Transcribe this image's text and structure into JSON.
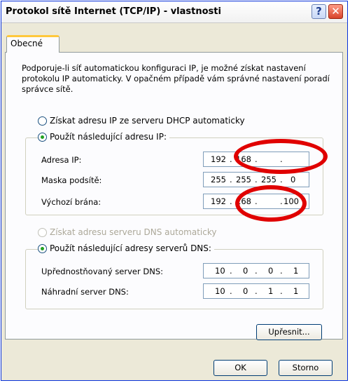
{
  "window": {
    "title": "Protokol sítě Internet (TCP/IP) - vlastnosti"
  },
  "titlebar": {
    "help_glyph": "?",
    "close_glyph": "✕"
  },
  "tabs": [
    {
      "label": "Obecné"
    }
  ],
  "intro": "Podporuje-li síť automatickou konfiguraci IP, je možné získat nastavení protokolu IP automaticky. V opačném případě vám správné nastavení poradí správce sítě.",
  "ip_section": {
    "dhcp_option": "Získat adresu IP ze serveru DHCP automaticky",
    "static_option": "Použít následující adresu IP:",
    "selected": "static",
    "fields": [
      {
        "label": "Adresa IP:",
        "octets": [
          "192",
          "168",
          "",
          ""
        ]
      },
      {
        "label": "Maska podsítě:",
        "octets": [
          "255",
          "255",
          "255",
          "0"
        ]
      },
      {
        "label": "Výchozí brána:",
        "octets": [
          "192",
          "168",
          "",
          "100"
        ]
      }
    ]
  },
  "dns_section": {
    "auto_option": "Získat adresu serveru DNS automaticky",
    "static_option": "Použít následující adresy serverů DNS:",
    "selected": "static",
    "fields": [
      {
        "label": "Upřednostňovaný server DNS:",
        "octets": [
          "10",
          "0",
          "0",
          "1"
        ]
      },
      {
        "label": "Náhradní server DNS:",
        "octets": [
          "10",
          "0",
          "1",
          "1"
        ]
      }
    ]
  },
  "buttons": {
    "advanced": "Upřesnit...",
    "ok": "OK",
    "cancel": "Storno"
  },
  "annotation": {
    "color": "#e00000"
  }
}
